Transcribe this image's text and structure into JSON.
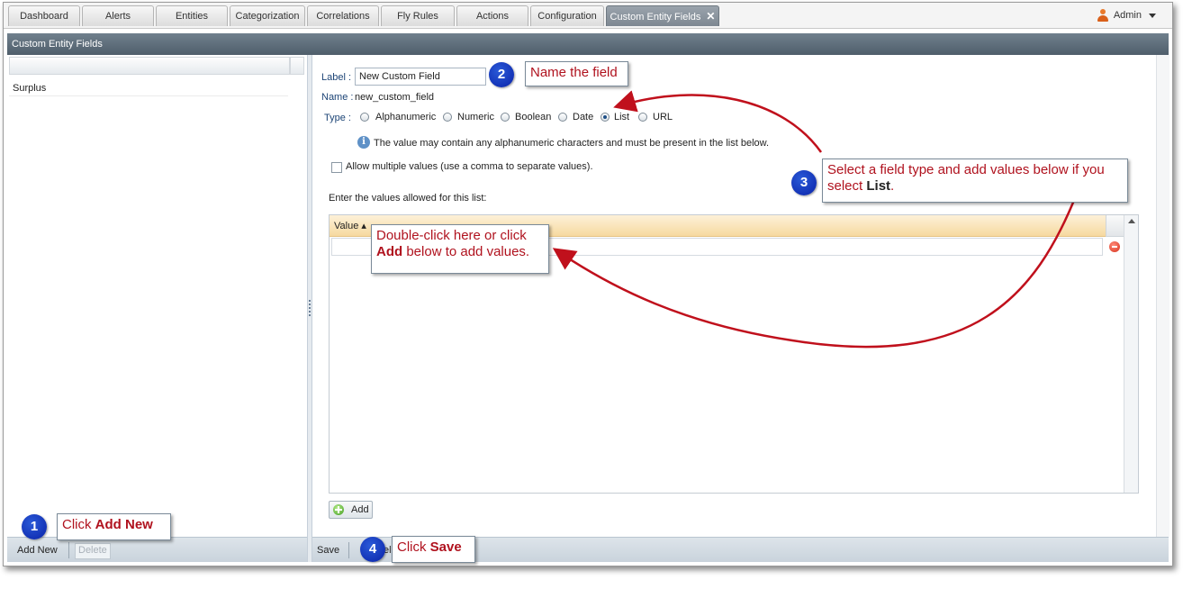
{
  "tabs": [
    {
      "label": "Dashboard"
    },
    {
      "label": "Alerts"
    },
    {
      "label": "Entities"
    },
    {
      "label": "Categorization"
    },
    {
      "label": "Correlations"
    },
    {
      "label": "Fly Rules"
    },
    {
      "label": "Actions"
    },
    {
      "label": "Configuration"
    },
    {
      "label": "Custom Entity Fields",
      "close": "✕"
    }
  ],
  "user": {
    "name": "Admin"
  },
  "panel": {
    "title": "Custom Entity Fields"
  },
  "left_list": {
    "items": [
      "Surplus"
    ]
  },
  "left_toolbar": {
    "add_new": "Add New",
    "delete": "Delete"
  },
  "form": {
    "label_label": "Label :",
    "label_value": "New Custom Field",
    "name_label": "Name :",
    "name_value": "new_custom_field",
    "type_label": "Type :",
    "types": [
      "Alphanumeric",
      "Numeric",
      "Boolean",
      "Date",
      "List",
      "URL"
    ],
    "selected_type": "List",
    "info_text": "The value may contain any alphanumeric characters and must be present in the list below.",
    "multiple_label": "Allow multiple values (use a comma to separate values).",
    "values_heading": "Enter the values allowed for this list:",
    "grid_column": "Value",
    "add_button": "Add"
  },
  "right_toolbar": {
    "save": "Save",
    "cancel_fragment": "el"
  },
  "callouts": {
    "c1": {
      "number": "1",
      "text_prefix": "Click ",
      "text_bold": "Add New"
    },
    "c2": {
      "number": "2",
      "text": "Name the field"
    },
    "c3": {
      "number": "3",
      "text_prefix": "Select a field type and add values below if you select ",
      "text_bold": "List",
      "text_suffix": "."
    },
    "c4": {
      "number": "4",
      "text_prefix": "Click ",
      "text_bold": "Save"
    },
    "c5": {
      "text_prefix": "Double-click here or click ",
      "text_bold": "Add",
      "text_suffix": " below to add values."
    }
  },
  "colors": {
    "accent_red": "#b0121e",
    "badge_blue": "#0a22a8",
    "header_bg": "#4f5e6b",
    "grid_header": "#f6d9a0"
  },
  "icons": [
    "user-icon",
    "info-icon",
    "remove-icon",
    "add-icon",
    "sort-asc-icon",
    "close-icon"
  ]
}
